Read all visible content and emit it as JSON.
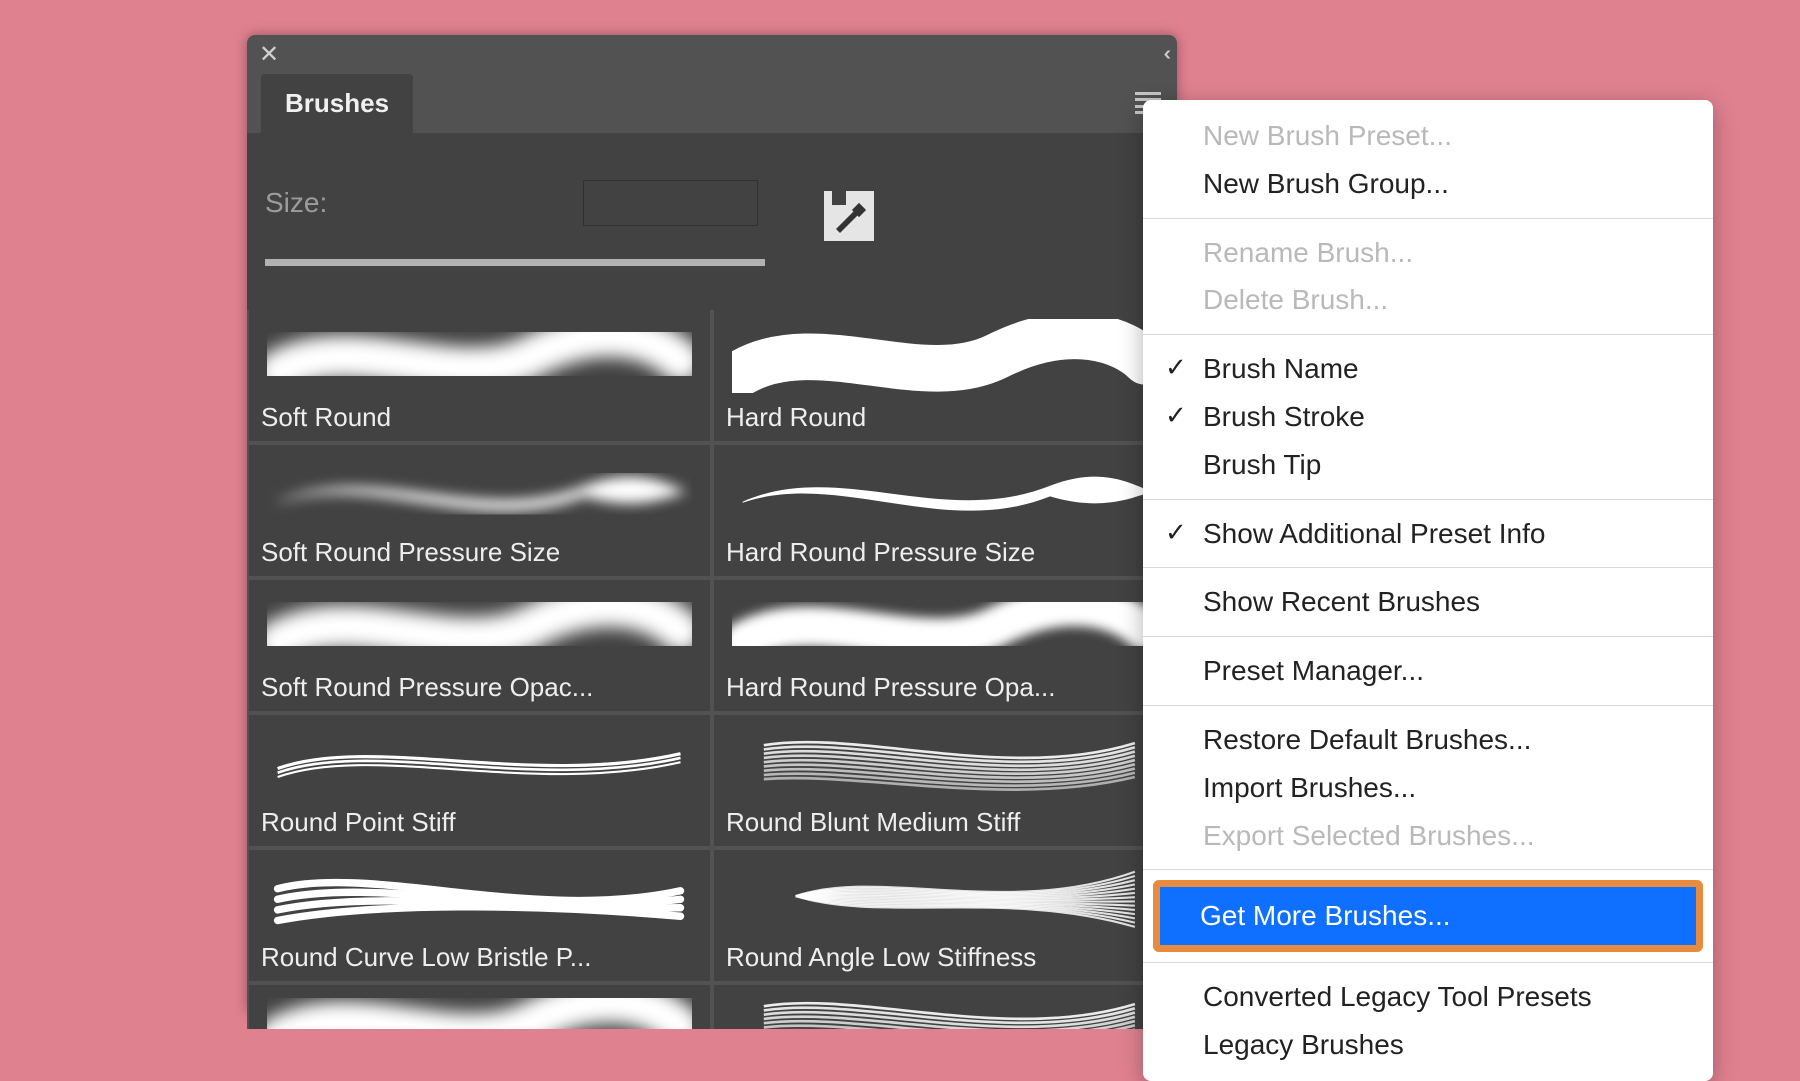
{
  "panel": {
    "tab": "Brushes",
    "size_label": "Size:"
  },
  "brushes": [
    {
      "name": "Soft Round",
      "style": "soft"
    },
    {
      "name": "Hard Round",
      "style": "hard"
    },
    {
      "name": "Soft Round Pressure Size",
      "style": "soft-taper"
    },
    {
      "name": "Hard Round Pressure Size",
      "style": "hard-taper"
    },
    {
      "name": "Soft Round Pressure Opac...",
      "style": "soft"
    },
    {
      "name": "Hard Round Pressure Opa...",
      "style": "soft-mid"
    },
    {
      "name": "Round Point Stiff",
      "style": "thin-bristle"
    },
    {
      "name": "Round Blunt Medium Stiff",
      "style": "multi-bristle"
    },
    {
      "name": "Round Curve Low Bristle P...",
      "style": "scribble"
    },
    {
      "name": "Round Angle Low Stiffness",
      "style": "fan-bristle"
    }
  ],
  "menu": [
    {
      "label": "New Brush Preset...",
      "disabled": true
    },
    {
      "label": "New Brush Group...",
      "disabled": false
    },
    {
      "sep": true
    },
    {
      "label": "Rename Brush...",
      "disabled": true
    },
    {
      "label": "Delete Brush...",
      "disabled": true
    },
    {
      "sep": true
    },
    {
      "label": "Brush Name",
      "checked": true
    },
    {
      "label": "Brush Stroke",
      "checked": true
    },
    {
      "label": "Brush Tip"
    },
    {
      "sep": true
    },
    {
      "label": "Show Additional Preset Info",
      "checked": true
    },
    {
      "sep": true
    },
    {
      "label": "Show Recent Brushes"
    },
    {
      "sep": true
    },
    {
      "label": "Preset Manager..."
    },
    {
      "sep": true
    },
    {
      "label": "Restore Default Brushes..."
    },
    {
      "label": "Import Brushes..."
    },
    {
      "label": "Export Selected Brushes...",
      "disabled": true
    },
    {
      "sep": true
    },
    {
      "label": "Get More Brushes...",
      "highlight": true
    },
    {
      "sep": true
    },
    {
      "label": "Converted Legacy Tool Presets"
    },
    {
      "label": "Legacy Brushes"
    }
  ]
}
